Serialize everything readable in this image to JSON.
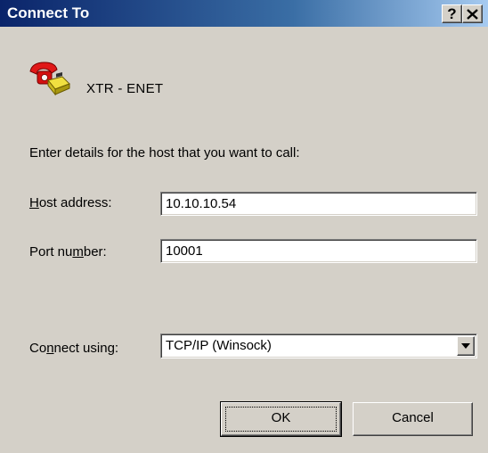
{
  "window": {
    "title": "Connect To",
    "help_glyph": "?"
  },
  "connection": {
    "icon": "telephone-icon",
    "name": "XTR - ENET"
  },
  "prompt": "Enter details for the host that you want to call:",
  "host_address": {
    "label_pre": "",
    "label_key": "H",
    "label_post": "ost address:",
    "value": "10.10.10.54"
  },
  "port_number": {
    "label_pre": "Port nu",
    "label_key": "m",
    "label_post": "ber:",
    "value": "10001"
  },
  "connect_using": {
    "label_pre": "Co",
    "label_key": "n",
    "label_post": "nect using:",
    "value": "TCP/IP (Winsock)"
  },
  "buttons": {
    "ok": "OK",
    "cancel": "Cancel"
  },
  "colors": {
    "title_bar_start": "#0a246a",
    "title_bar_end": "#a6caf0",
    "dialog_bg": "#d4d0c8"
  }
}
